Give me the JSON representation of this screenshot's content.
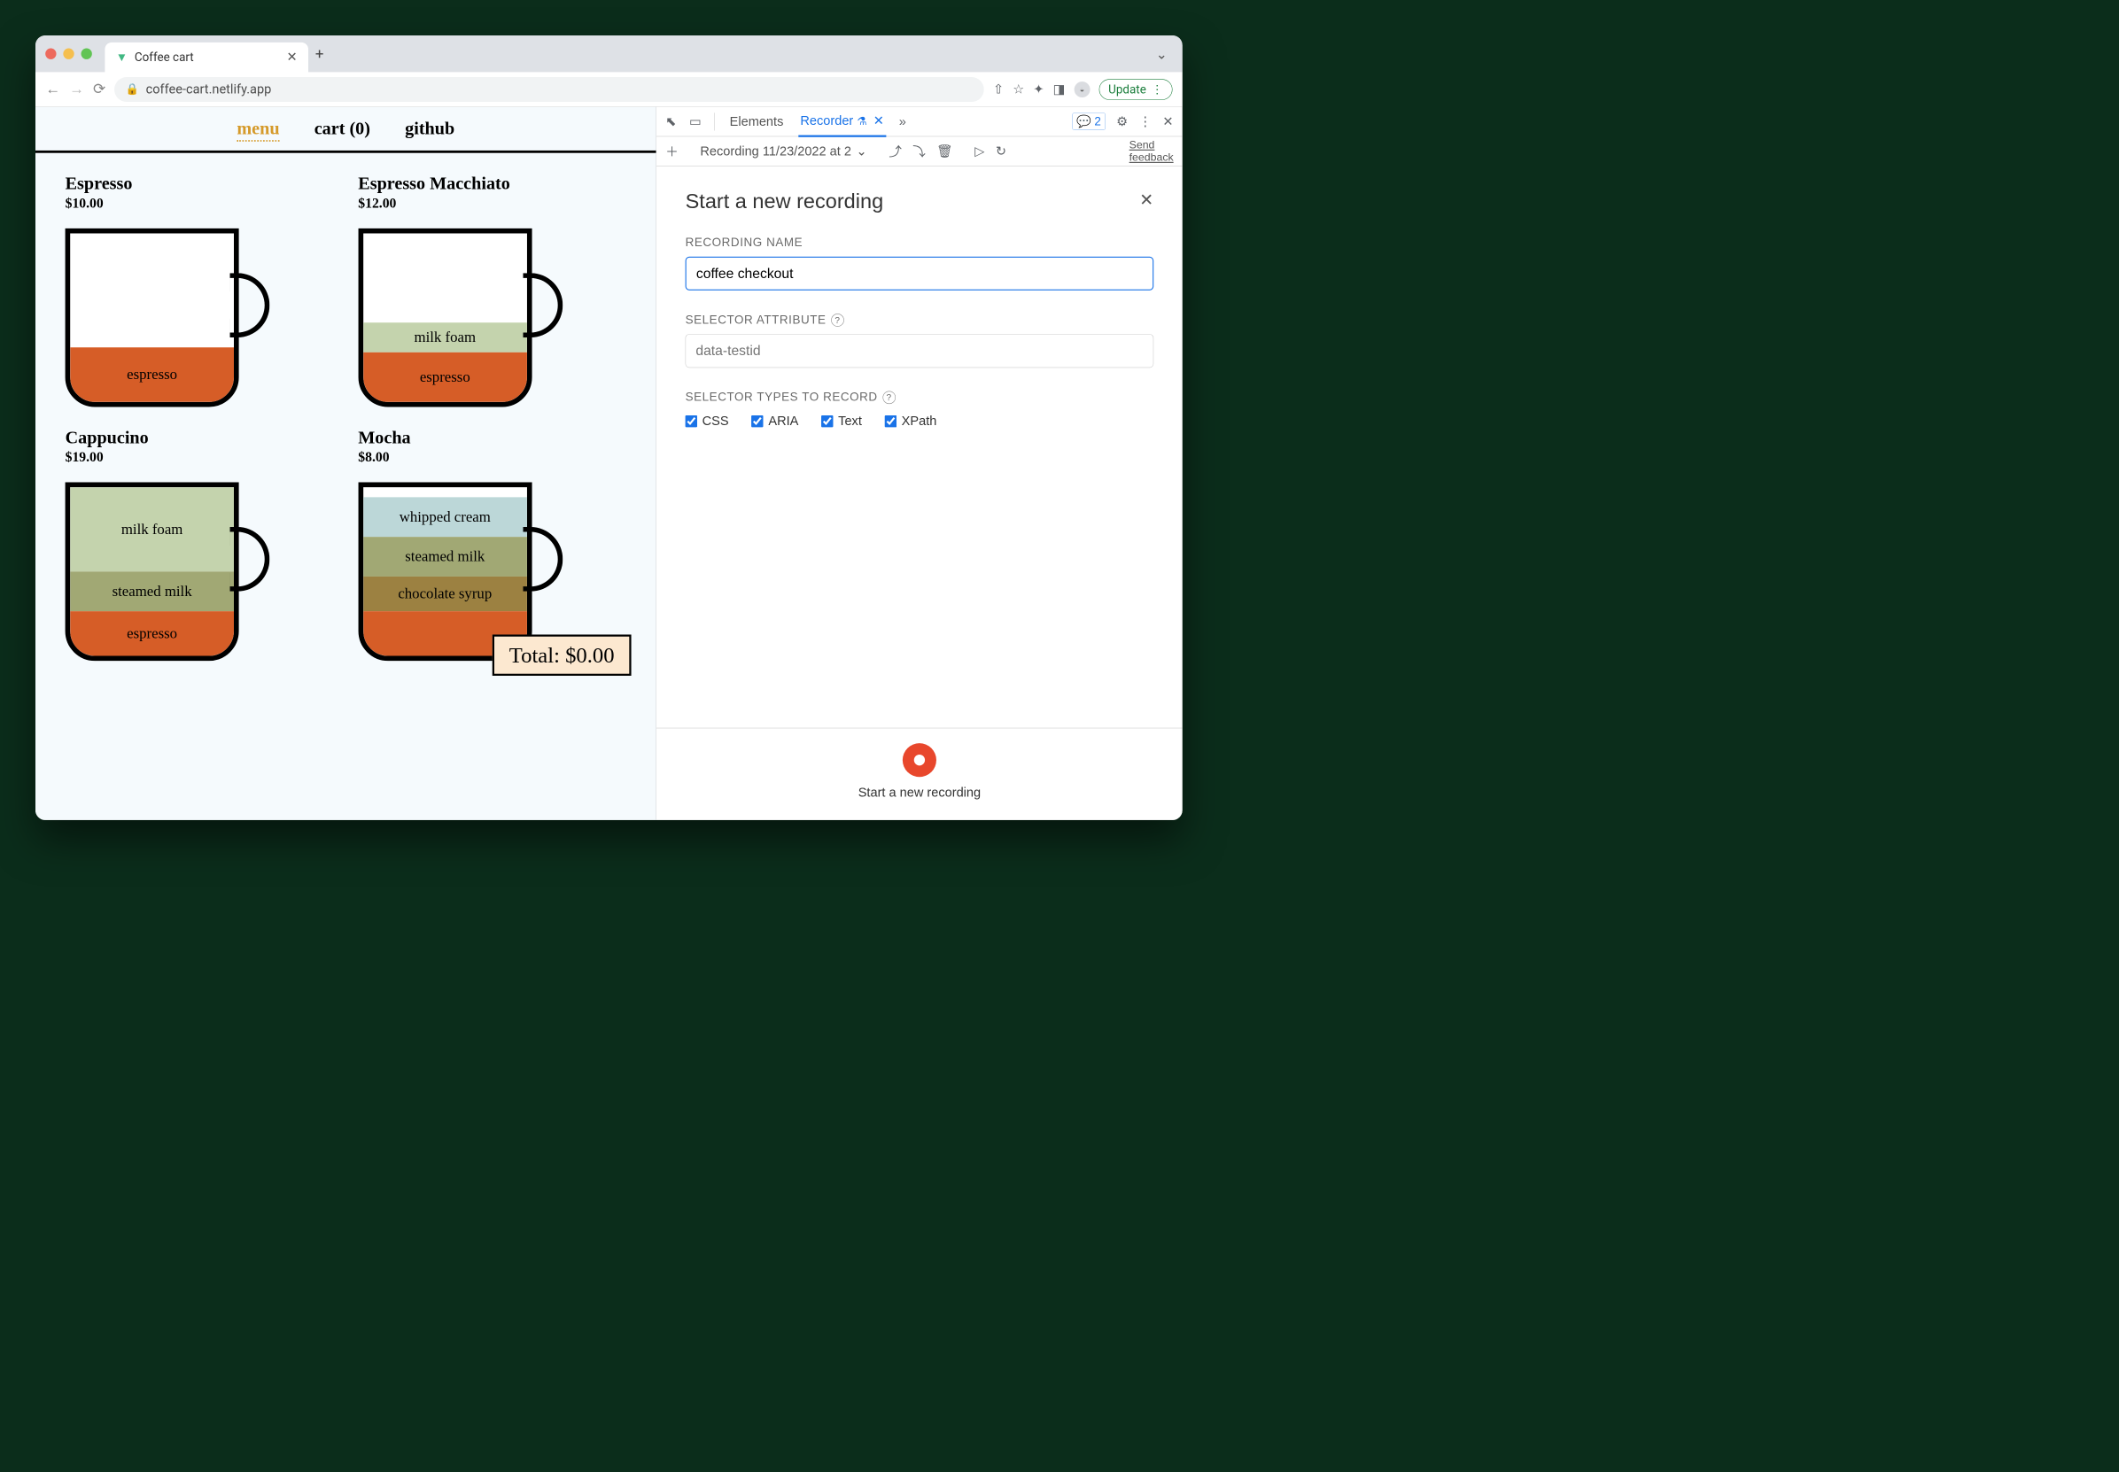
{
  "browser": {
    "tab_title": "Coffee cart",
    "url": "coffee-cart.netlify.app",
    "update_label": "Update"
  },
  "page": {
    "nav": {
      "menu": "menu",
      "cart": "cart (0)",
      "github": "github"
    },
    "items": [
      {
        "name": "Espresso",
        "price": "$10.00",
        "layerA": "espresso"
      },
      {
        "name": "Espresso Macchiato",
        "price": "$12.00",
        "layerA": "milk foam",
        "layerB": "espresso"
      },
      {
        "name": "Cappucino",
        "price": "$19.00",
        "layerA": "milk foam",
        "layerB": "steamed milk",
        "layerC": "espresso"
      },
      {
        "name": "Mocha",
        "price": "$8.00",
        "layerA": "whipped cream",
        "layerB": "steamed milk",
        "layerC": "chocolate syrup"
      }
    ],
    "total": "Total: $0.00"
  },
  "devtools": {
    "tabs": {
      "elements": "Elements",
      "recorder": "Recorder"
    },
    "issues_count": "2",
    "toolbar": {
      "recording_select": "Recording 11/23/2022 at 2",
      "feedback1": "Send",
      "feedback2": "feedback"
    },
    "panel": {
      "heading": "Start a new recording",
      "name_label": "RECORDING NAME",
      "name_value": "coffee checkout",
      "selector_attr_label": "SELECTOR ATTRIBUTE",
      "selector_attr_placeholder": "data-testid",
      "types_label": "SELECTOR TYPES TO RECORD",
      "types": {
        "css": "CSS",
        "aria": "ARIA",
        "text": "Text",
        "xpath": "XPath"
      },
      "footer_label": "Start a new recording"
    }
  }
}
